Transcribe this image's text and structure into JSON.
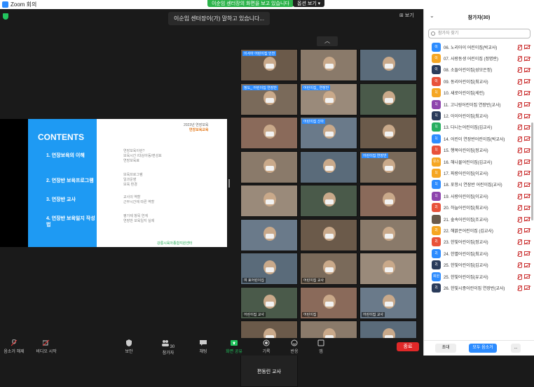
{
  "window": {
    "title": "Zoom 회의"
  },
  "banner": {
    "sharing_text": "이순임 센터장의 화면을 보고 있습니다",
    "view_options": "옵션 보기 ▾"
  },
  "speaking": {
    "text": "이순임 센터장이(가) 말하고 있습니다..."
  },
  "view_label": "⊞ 보기",
  "slide": {
    "title": "CONTENTS",
    "brand_line1": "2023년 연장보육",
    "brand_line2": "연장보육교육",
    "items": [
      {
        "label": "1. 연장보육의 이해",
        "subs": [
          "연장보육이란?",
          "보육시간 /대상아동/편성표",
          "연장보육료"
        ]
      },
      {
        "label": "2. 연장반 보육프로그램",
        "subs": [
          "보육프로그램",
          "일과운영",
          "보육 환경"
        ]
      },
      {
        "label": "3. 연장반 교사",
        "subs": [
          "교사의 역할",
          "근무시간에 따른 역할"
        ]
      },
      {
        "label": "4. 연장반 보육일지 작성법",
        "subs": [
          "평가제 항목 연계",
          "연장반 보육일지 실제"
        ]
      }
    ],
    "footer_logo": "강릉시육아종합지원센터"
  },
  "tiles": [
    {
      "name": "",
      "tag": "이서아 어린이집 인천"
    },
    {
      "name": ""
    },
    {
      "name": ""
    },
    {
      "name": "",
      "tag": "정도_ 어린이집 연장반"
    },
    {
      "name": "",
      "tag": "어린이집_ 연장반"
    },
    {
      "name": ""
    },
    {
      "name": ""
    },
    {
      "name": "",
      "tag": "어린이집 신아"
    },
    {
      "name": ""
    },
    {
      "name": ""
    },
    {
      "name": ""
    },
    {
      "name": "",
      "tag": "어린이집 연장반"
    },
    {
      "name": ""
    },
    {
      "name": ""
    },
    {
      "name": ""
    },
    {
      "name": ""
    },
    {
      "name": ""
    },
    {
      "name": ""
    },
    {
      "name": "여 효어린이집"
    },
    {
      "name": "어린이집 교사"
    },
    {
      "name": ""
    },
    {
      "name": "어린이집 교사"
    },
    {
      "name": "어린이집"
    },
    {
      "name": "어린이집 교사"
    },
    {
      "name": "어린이집 교사"
    },
    {
      "name": "어린이집 교사"
    },
    {
      "name": ""
    },
    {
      "name": "",
      "dark": "편동린 교사"
    }
  ],
  "toolbar": {
    "items": [
      {
        "label": "음소거 해제",
        "icon": "mic-muted-icon"
      },
      {
        "label": "비디오 시작",
        "icon": "video-off-icon"
      },
      {
        "label": "보안",
        "icon": "shield-icon"
      },
      {
        "label": "참가자",
        "icon": "participants-icon",
        "count": "30"
      },
      {
        "label": "채팅",
        "icon": "chat-icon"
      },
      {
        "label": "화면 공유",
        "icon": "share-screen-icon"
      },
      {
        "label": "기록",
        "icon": "record-icon"
      },
      {
        "label": "반응",
        "icon": "reaction-icon"
      },
      {
        "label": "앱",
        "icon": "apps-icon"
      }
    ],
    "end": "종료"
  },
  "participants": {
    "title": "참가자(30)",
    "search_placeholder": "참가자 찾기",
    "list": [
      {
        "badge": "0|",
        "color": "#2d8cff",
        "name": "06. 노리아이 어린이집(박교사)"
      },
      {
        "badge": "0|",
        "color": "#f5a623",
        "name": "07. 사랑동생 어린이집 (정명란)"
      },
      {
        "badge": "0|",
        "color": "#2a3b5a",
        "name": "08. 소들어린이집(성모은정)"
      },
      {
        "badge": "0|",
        "color": "#e8523a",
        "name": "09. 동리어린이집(최교사)"
      },
      {
        "badge": "1|",
        "color": "#f5a623",
        "name": "10. 새로어린이집(세린)"
      },
      {
        "badge": "1|",
        "color": "#8e44ad",
        "name": "11. 고니링어린이집 연장반(교사)"
      },
      {
        "badge": "1|",
        "color": "#2a3b5a",
        "name": "12. 아이어린이집(최교사)"
      },
      {
        "badge": "1|",
        "color": "#27ae60",
        "name": "13. 다니는어린이집(김교사)"
      },
      {
        "badge": "1|",
        "color": "#2d8cff",
        "name": "14. 어린이 연장반어린이집(박교사)"
      },
      {
        "badge": "1|",
        "color": "#e8523a",
        "name": "15. 행복어린이집(정교사)"
      },
      {
        "badge": "유스",
        "color": "#f5a623",
        "name": "16. 해나물어린이집(김교사)"
      },
      {
        "badge": "1|",
        "color": "#f5a623",
        "name": "17. 파랑어린이집(이교사)"
      },
      {
        "badge": "1|",
        "color": "#2d8cff",
        "name": "18. 포항시 연장반 어린이집(교사)"
      },
      {
        "badge": "1|",
        "color": "#8e44ad",
        "name": "19. 사랑어린이집(이교사)"
      },
      {
        "badge": "2|",
        "color": "#e8523a",
        "name": "20. 하늘어린이집(최교사)"
      },
      {
        "badge": "",
        "color": "#6b5a4a",
        "name": "21. 숲속어린이집(조교사)"
      },
      {
        "badge": "2|",
        "color": "#f5a623",
        "name": "22. 해맑은어린이집 (김교사)"
      },
      {
        "badge": "2|",
        "color": "#e8523a",
        "name": "23. 한빛어린이집(정교사)"
      },
      {
        "badge": "2|",
        "color": "#2d8cff",
        "name": "24. 한별어린이집(최교사)"
      },
      {
        "badge": "2|",
        "color": "#2a3b5a",
        "name": "25. 한빛어린이집(김교사)"
      },
      {
        "badge": "회원",
        "color": "#2d8cff",
        "name": "25. 한빛어린이집(유교사)"
      },
      {
        "badge": "2|",
        "color": "#2a3b5a",
        "name": "26. 한빛시종어린이집 연장반(교사)"
      }
    ],
    "footer": {
      "invite": "초대",
      "mute_all": "모두 음소거",
      "more": "..."
    }
  }
}
